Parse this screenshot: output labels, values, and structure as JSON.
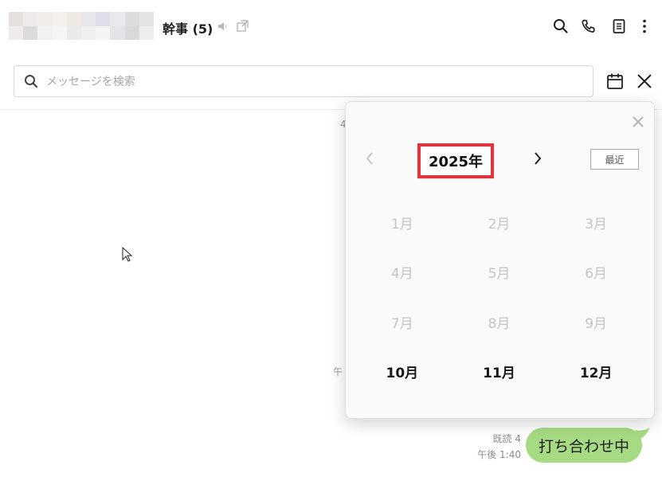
{
  "header": {
    "title": "幹事 (5)",
    "icons": [
      "mute-icon",
      "popout-icon",
      "search-icon",
      "phone-icon",
      "notes-icon",
      "more-icon"
    ]
  },
  "search": {
    "placeholder": "メッセージを検索",
    "value": ""
  },
  "background_peek": {
    "top_fragment": "4",
    "mid_fragment": "午"
  },
  "message": {
    "read_status": "既読 4",
    "time": "午後 1:40",
    "text": "打ち合わせ中",
    "bubble_color": "#a7db83"
  },
  "calendar": {
    "year_label": "2025年",
    "recent_label": "最近",
    "highlight_color": "#e0333f",
    "months": [
      {
        "label": "1月",
        "enabled": false
      },
      {
        "label": "2月",
        "enabled": false
      },
      {
        "label": "3月",
        "enabled": false
      },
      {
        "label": "4月",
        "enabled": false
      },
      {
        "label": "5月",
        "enabled": false
      },
      {
        "label": "6月",
        "enabled": false
      },
      {
        "label": "7月",
        "enabled": false
      },
      {
        "label": "8月",
        "enabled": false
      },
      {
        "label": "9月",
        "enabled": false
      },
      {
        "label": "10月",
        "enabled": true
      },
      {
        "label": "11月",
        "enabled": true
      },
      {
        "label": "12月",
        "enabled": true
      }
    ]
  }
}
